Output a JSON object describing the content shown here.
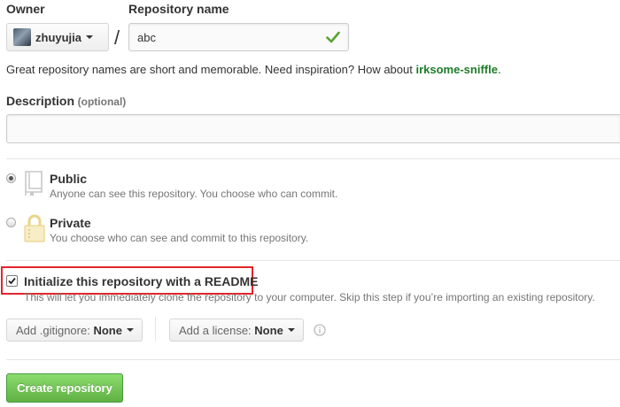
{
  "owner": {
    "label": "Owner",
    "username": "zhuyujia"
  },
  "repo_name": {
    "label": "Repository name",
    "value": "abc",
    "separator": "/"
  },
  "hint": {
    "text": "Great repository names are short and memorable. Need inspiration? How about",
    "suggestion": "irksome-sniffle",
    "end": "."
  },
  "description": {
    "label": "Description",
    "optional": "(optional)",
    "value": ""
  },
  "visibility": {
    "public": {
      "title": "Public",
      "desc": "Anyone can see this repository. You choose who can commit.",
      "selected": true
    },
    "private": {
      "title": "Private",
      "desc": "You choose who can see and commit to this repository.",
      "selected": false
    }
  },
  "readme": {
    "label": "Initialize this repository with a README",
    "desc": "This will let you immediately clone the repository to your computer. Skip this step if you’re importing an existing repository.",
    "checked": true,
    "highlight_color": "#e3262a"
  },
  "gitignore": {
    "label": "Add .gitignore:",
    "value": "None"
  },
  "license": {
    "label": "Add a license:",
    "value": "None"
  },
  "submit": {
    "label": "Create repository",
    "color": "#55a532"
  },
  "colors": {
    "suggestion": "#1e7c28",
    "check": "#55a532"
  }
}
